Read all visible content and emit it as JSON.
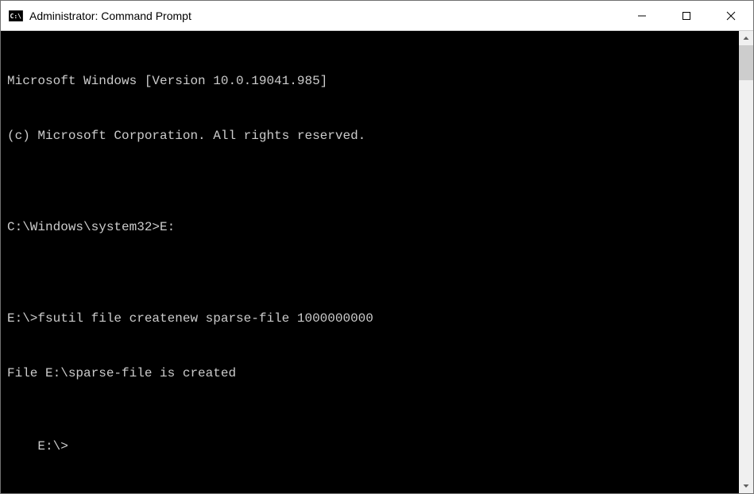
{
  "window": {
    "title": "Administrator: Command Prompt"
  },
  "terminal": {
    "lines": [
      "Microsoft Windows [Version 10.0.19041.985]",
      "(c) Microsoft Corporation. All rights reserved.",
      "",
      "C:\\Windows\\system32>E:",
      "",
      "E:\\>fsutil file createnew sparse-file 1000000000",
      "File E:\\sparse-file is created",
      "",
      "E:\\>"
    ]
  }
}
